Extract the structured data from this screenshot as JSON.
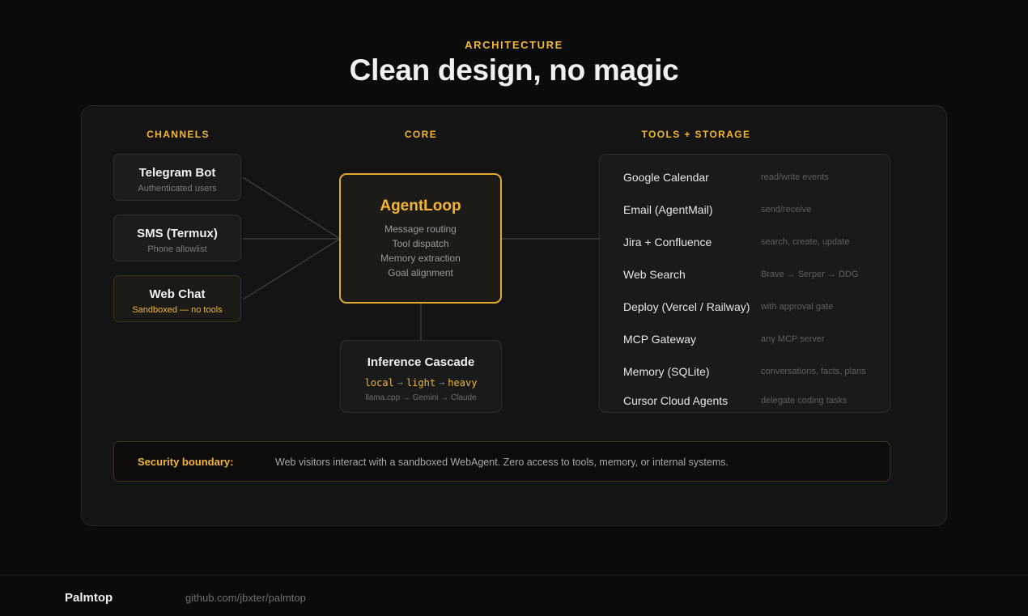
{
  "header": {
    "eyebrow": "ARCHITECTURE",
    "title": "Clean design, no magic"
  },
  "columns": {
    "channels": "CHANNELS",
    "core": "CORE",
    "tools": "TOOLS + STORAGE"
  },
  "channels": [
    {
      "title": "Telegram Bot",
      "sub": "Authenticated users"
    },
    {
      "title": "SMS (Termux)",
      "sub": "Phone allowlist"
    },
    {
      "title": "Web Chat",
      "sub": "Sandboxed — no tools"
    }
  ],
  "core": {
    "title": "AgentLoop",
    "lines": [
      "Message routing",
      "Tool dispatch",
      "Memory extraction",
      "Goal alignment"
    ]
  },
  "inference": {
    "title": "Inference Cascade",
    "tiers": [
      "local",
      "light",
      "heavy"
    ],
    "arrow": "→",
    "models": "llama.cpp → Gemini → Claude"
  },
  "tools": [
    {
      "name": "Google Calendar",
      "desc": "read/write events"
    },
    {
      "name": "Email (AgentMail)",
      "desc": "send/receive"
    },
    {
      "name": "Jira + Confluence",
      "desc": "search, create, update"
    },
    {
      "name": "Web Search",
      "desc": "Brave → Serper → DDG"
    },
    {
      "name": "Deploy (Vercel / Railway)",
      "desc": "with approval gate"
    },
    {
      "name": "MCP Gateway",
      "desc": "any MCP server"
    },
    {
      "name": "Memory (SQLite)",
      "desc": "conversations, facts, plans"
    },
    {
      "name": "Cursor Cloud Agents",
      "desc": "delegate coding tasks"
    }
  ],
  "security": {
    "label": "Security boundary:",
    "text": "Web visitors interact with a sandboxed WebAgent. Zero access to tools, memory, or internal systems."
  },
  "footer": {
    "brand": "Palmtop",
    "repo": "github.com/jbxter/palmtop"
  },
  "colors": {
    "accent": "#f2b632",
    "background": "#0b0b0b",
    "panel": "#141414"
  }
}
